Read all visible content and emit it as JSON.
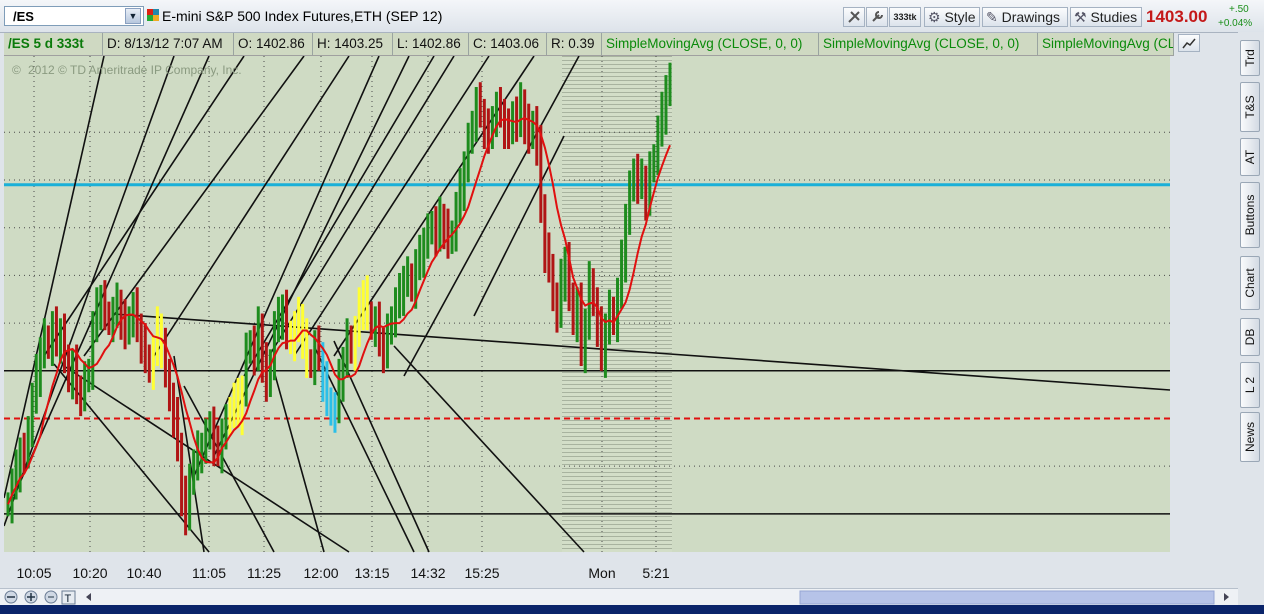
{
  "toolbar": {
    "symbol": "/ES",
    "description": "E-mini S&P 500 Index Futures,ETH (SEP 12)",
    "agg_badge": "333tk",
    "style_label": "Style",
    "drawings_label": "Drawings",
    "studies_label": "Studies",
    "last_price": "1403.00",
    "net_change": "+.50",
    "pct_change": "+0.04%"
  },
  "info": {
    "symbol_period": "/ES 5 d 333t",
    "date": "D: 8/13/12 7:07 AM",
    "open": "O: 1402.86",
    "high": "H: 1403.25",
    "low": "L: 1402.86",
    "close": "C: 1403.06",
    "range": "R: 0.39",
    "studies": [
      "SimpleMovingAvg (CLOSE, 0, 0)",
      "SimpleMovingAvg (CLOSE, 0, 0)",
      "SimpleMovingAvg (CLOSE, 0, 0)"
    ]
  },
  "watermark": "2012 © TD Ameritrade IP Company, Inc.",
  "sidebar": [
    "Trd",
    "T&S",
    "AT",
    "Buttons",
    "Chart",
    "DB",
    "L 2",
    "News"
  ],
  "colors": {
    "chart_bg": "#cfdbc4",
    "future_bg": "#d4dfc8",
    "up_bar": "#1e8c1e",
    "down_bar": "#b01515",
    "sma": "#e01010",
    "cyan_line": "#1ab0d8",
    "dash_line": "#e01010",
    "yellow_bar": "#ffff33",
    "cyan_bar": "#2bbfe8",
    "price_label": "#0d8f0d"
  },
  "chart_data": {
    "type": "candlestick",
    "title": "",
    "ylim": [
      1393.2,
      1403.6
    ],
    "yticks": [
      1394,
      1395,
      1396,
      1397,
      1398,
      1399,
      1400,
      1401,
      1402
    ],
    "last_price_label": "1403.06",
    "x_labels": [
      "10:05",
      "10:20",
      "10:40",
      "11:05",
      "11:25",
      "12:00",
      "13:15",
      "14:32",
      "15:25",
      "Mon",
      "5:21"
    ],
    "closes": [
      1394.2,
      1394.6,
      1394.9,
      1395.3,
      1395.2,
      1395.8,
      1396.4,
      1396.9,
      1397.4,
      1397.7,
      1397.5,
      1397.9,
      1397.6,
      1397.8,
      1397.3,
      1396.8,
      1397.1,
      1396.6,
      1396.5,
      1396.8,
      1397.0,
      1397.9,
      1398.3,
      1398.5,
      1398.2,
      1398.0,
      1398.2,
      1398.4,
      1398.1,
      1397.8,
      1398.1,
      1398.3,
      1397.9,
      1397.6,
      1397.3,
      1397.0,
      1397.4,
      1397.9,
      1397.5,
      1397.0,
      1396.4,
      1396.0,
      1395.4,
      1394.4,
      1393.9,
      1394.8,
      1395.0,
      1395.3,
      1395.4,
      1395.6,
      1395.9,
      1395.4,
      1395.3,
      1395.7,
      1395.9,
      1396.2,
      1396.4,
      1396.1,
      1396.6,
      1397.4,
      1397.6,
      1397.3,
      1397.9,
      1397.2,
      1396.7,
      1397.2,
      1397.9,
      1398.1,
      1398.3,
      1397.8,
      1397.6,
      1397.9,
      1398.1,
      1397.7,
      1397.2,
      1397.1,
      1397.5,
      1397.3,
      1396.8,
      1396.4,
      1396.1,
      1396.2,
      1396.8,
      1397.2,
      1397.7,
      1397.4,
      1397.8,
      1398.3,
      1398.6,
      1398.2,
      1397.9,
      1398.0,
      1397.6,
      1397.4,
      1397.8,
      1398.1,
      1398.4,
      1398.6,
      1398.9,
      1399.0,
      1398.7,
      1399.2,
      1399.4,
      1399.7,
      1399.9,
      1400.1,
      1399.8,
      1400.2,
      1400.0,
      1399.7,
      1399.9,
      1400.4,
      1400.8,
      1401.3,
      1401.8,
      1402.2,
      1402.6,
      1402.4,
      1402.1,
      1401.9,
      1402.3,
      1402.5,
      1402.4,
      1402.1,
      1402.0,
      1402.4,
      1402.2,
      1402.6,
      1402.2,
      1401.9,
      1402.2,
      1401.7,
      1400.4,
      1399.5,
      1399.2,
      1398.5,
      1398.2,
      1398.9,
      1399.3,
      1398.6,
      1398.0,
      1398.4,
      1397.4,
      1398.0,
      1398.9,
      1398.4,
      1397.9,
      1397.3,
      1397.9,
      1398.3,
      1398.0,
      1398.6,
      1399.3,
      1400.2,
      1400.8,
      1401.2,
      1400.9,
      1401.0,
      1400.6,
      1401.2,
      1401.5,
      1402.0,
      1402.4,
      1402.9,
      1403.06
    ]
  }
}
